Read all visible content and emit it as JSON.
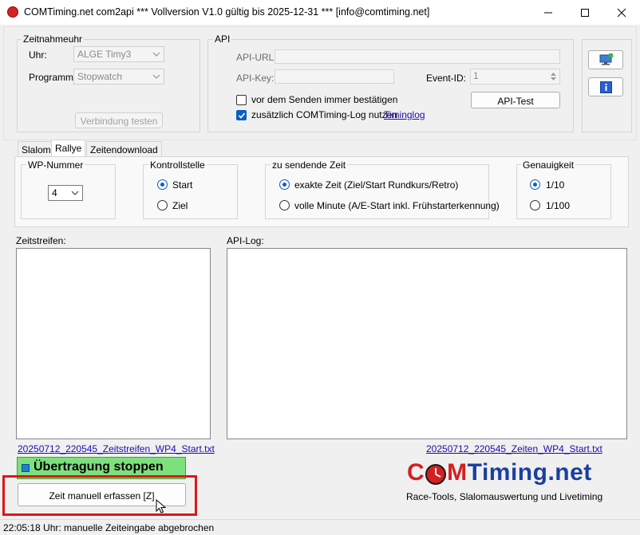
{
  "window": {
    "title": "COMTiming.net com2api *** Vollversion V1.0 gültig bis 2025-12-31 *** [info@comtiming.net]"
  },
  "zeitnahmeuhr": {
    "legend": "Zeitnahmeuhr",
    "uhr_label": "Uhr:",
    "uhr_value": "ALGE Timy3",
    "programm_label": "Programm:",
    "programm_value": "Stopwatch",
    "test_button": "Verbindung testen"
  },
  "api": {
    "legend": "API",
    "url_label": "API-URL:",
    "url_value": "",
    "key_label": "API-Key:",
    "key_value": "",
    "event_label": "Event-ID:",
    "event_value": "1",
    "confirm_label": "vor dem Senden immer bestätigen",
    "confirm_checked": false,
    "log_label": "zusätzlich COMTiming-Log nutzen",
    "log_checked": true,
    "timinglog_link": "Timinglog",
    "test_button": "API-Test"
  },
  "tabs": [
    {
      "label": "Slalom",
      "active": false
    },
    {
      "label": "Rallye",
      "active": true
    },
    {
      "label": "Zeitendownload",
      "active": false
    }
  ],
  "rallye": {
    "wp": {
      "legend": "WP-Nummer",
      "value": "4"
    },
    "kontrollstelle": {
      "legend": "Kontrollstelle",
      "options": [
        "Start",
        "Ziel"
      ],
      "selected": "Start"
    },
    "zeit": {
      "legend": "zu sendende Zeit",
      "options": [
        "exakte Zeit (Ziel/Start Rundkurs/Retro)",
        "volle Minute (A/E-Start inkl. Frühstarterkennung)"
      ],
      "selected": "exakte Zeit (Ziel/Start Rundkurs/Retro)"
    },
    "genauigkeit": {
      "legend": "Genauigkeit",
      "options": [
        "1/10",
        "1/100"
      ],
      "selected": "1/10"
    }
  },
  "zeitstreifen": {
    "label": "Zeitstreifen:",
    "file_link": "20250712_220545_Zeitstreifen_WP4_Start.txt"
  },
  "apilog": {
    "label": "API-Log:",
    "file_link": "20250712_220545_Zeiten_WP4_Start.txt"
  },
  "actions": {
    "stop_button": "Übertragung stoppen",
    "manual_button": "Zeit manuell erfassen [Z]"
  },
  "logo": {
    "brand_c": "C",
    "brand_o": "O",
    "brand_rest_red": "M",
    "brand_blue": "Timing.net",
    "tagline": "Race-Tools, Slalomauswertung und Livetiming"
  },
  "status": {
    "text": "22:05:18 Uhr: manuelle Zeiteingabe abgebrochen"
  },
  "colors": {
    "accent": "#0a5fc0",
    "stop_button": "#7de07d",
    "highlight_frame": "#e01515",
    "logo_blue": "#1a3f9e",
    "logo_red": "#d42020"
  }
}
